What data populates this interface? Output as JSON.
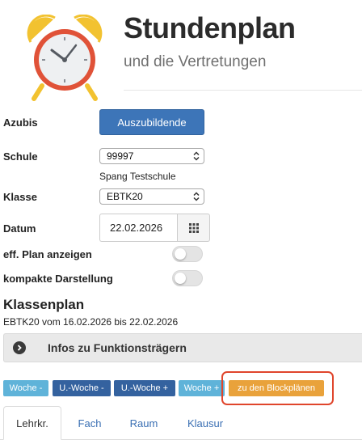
{
  "header": {
    "title": "Stundenplan",
    "subtitle": "und die Vertretungen",
    "logo_icon": "alarm-clock-icon"
  },
  "form": {
    "azubis_label": "Azubis",
    "azubis_button": "Auszubildende",
    "schule_label": "Schule",
    "schule_value": "99997",
    "schule_name": "Spang Testschule",
    "klasse_label": "Klasse",
    "klasse_value": "EBTK20",
    "datum_label": "Datum",
    "datum_value": "22.02.2026",
    "calendar_icon": "calendar-grid-icon",
    "eff_plan_label": "eff. Plan anzeigen",
    "eff_plan_on": false,
    "kompakt_label": "kompakte Darstellung",
    "kompakt_on": false
  },
  "klassenplan": {
    "title": "Klassenplan",
    "range": "EBTK20 vom 16.02.2026 bis 22.02.2026",
    "info_bar": "Infos zu Funktionsträgern"
  },
  "week_buttons": {
    "woche_minus": "Woche -",
    "u_woche_minus": "U.-Woche -",
    "u_woche_plus": "U.-Woche +",
    "woche_plus": "Woche +",
    "blockplaene": "zu den Blockplänen"
  },
  "tabs": [
    "Lehrkr.",
    "Fach",
    "Raum",
    "Klausur"
  ],
  "colors": {
    "primary": "#3d75b8",
    "light_blue": "#5fb3d9",
    "dark_blue": "#34629f",
    "orange": "#e9a23b",
    "highlight_red": "#e0452c"
  }
}
